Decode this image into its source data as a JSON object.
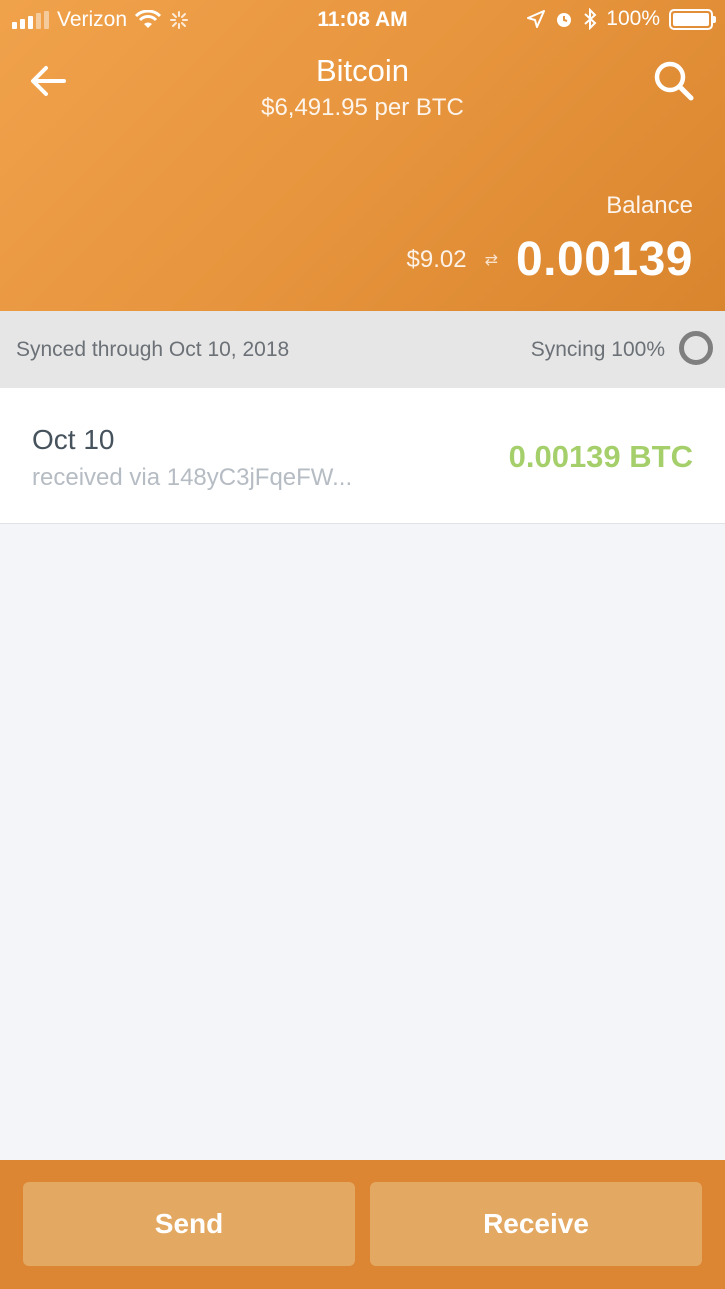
{
  "status_bar": {
    "carrier": "Verizon",
    "time": "11:08 AM",
    "battery": "100%"
  },
  "header": {
    "title": "Bitcoin",
    "price": "$6,491.95 per BTC",
    "balance_label": "Balance",
    "balance_fiat": "$9.02",
    "swap_glyph": "⇄",
    "balance_crypto": "0.00139"
  },
  "sync": {
    "synced_text": "Synced through Oct 10, 2018",
    "syncing_text": "Syncing 100%"
  },
  "transactions": [
    {
      "date": "Oct 10",
      "description": "received via 148yC3jFqeFW...",
      "amount": "0.00139 BTC"
    }
  ],
  "actions": {
    "send_label": "Send",
    "receive_label": "Receive"
  },
  "colors": {
    "header_orange": "#e8963f",
    "bottom_bar": "#dc8633",
    "received_green": "#a5cf6a"
  },
  "icons": {
    "back": "arrow-left-icon",
    "search": "search-icon",
    "swap": "swap-arrows-icon",
    "sync_status": "sync-ring-icon"
  }
}
